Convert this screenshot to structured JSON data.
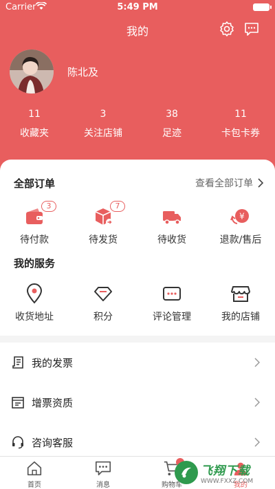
{
  "status_bar": {
    "carrier": "Carrier",
    "time": "5:49 PM"
  },
  "header": {
    "title": "我的",
    "icons": [
      "settings-icon",
      "message-icon"
    ]
  },
  "profile": {
    "username": "陈北及"
  },
  "stats": [
    {
      "num": "11",
      "label": "收藏夹"
    },
    {
      "num": "3",
      "label": "关注店铺"
    },
    {
      "num": "38",
      "label": "足迹"
    },
    {
      "num": "11",
      "label": "卡包卡券"
    }
  ],
  "orders": {
    "title": "全部订单",
    "view_all": "查看全部订单",
    "items": [
      {
        "label": "待付款",
        "badge": "3",
        "icon": "wallet-icon"
      },
      {
        "label": "待发货",
        "badge": "7",
        "icon": "package-icon"
      },
      {
        "label": "待收货",
        "badge": "",
        "icon": "truck-icon"
      },
      {
        "label": "退款/售后",
        "badge": "",
        "icon": "refund-icon"
      }
    ]
  },
  "services": {
    "title": "我的服务",
    "items": [
      {
        "label": "收货地址",
        "icon": "location-icon"
      },
      {
        "label": "积分",
        "icon": "diamond-icon"
      },
      {
        "label": "评论管理",
        "icon": "comment-icon"
      },
      {
        "label": "我的店铺",
        "icon": "store-icon"
      }
    ]
  },
  "menu": [
    {
      "label": "我的发票",
      "icon": "invoice-icon"
    },
    {
      "label": "增票资质",
      "icon": "vat-invoice-icon"
    },
    {
      "label": "咨询客服",
      "icon": "headset-icon"
    }
  ],
  "tabbar": [
    {
      "label": "首页",
      "icon": "home-icon",
      "active": false
    },
    {
      "label": "消息",
      "icon": "chat-icon",
      "active": false
    },
    {
      "label": "购物车",
      "icon": "cart-icon",
      "active": false
    },
    {
      "label": "我的",
      "icon": "user-icon",
      "active": true
    }
  ],
  "watermark": {
    "main": "飞翔下载",
    "sub": "WWW.FXXZ.COM"
  },
  "colors": {
    "accent": "#e85e5e",
    "watermark": "#2f9a4e"
  }
}
